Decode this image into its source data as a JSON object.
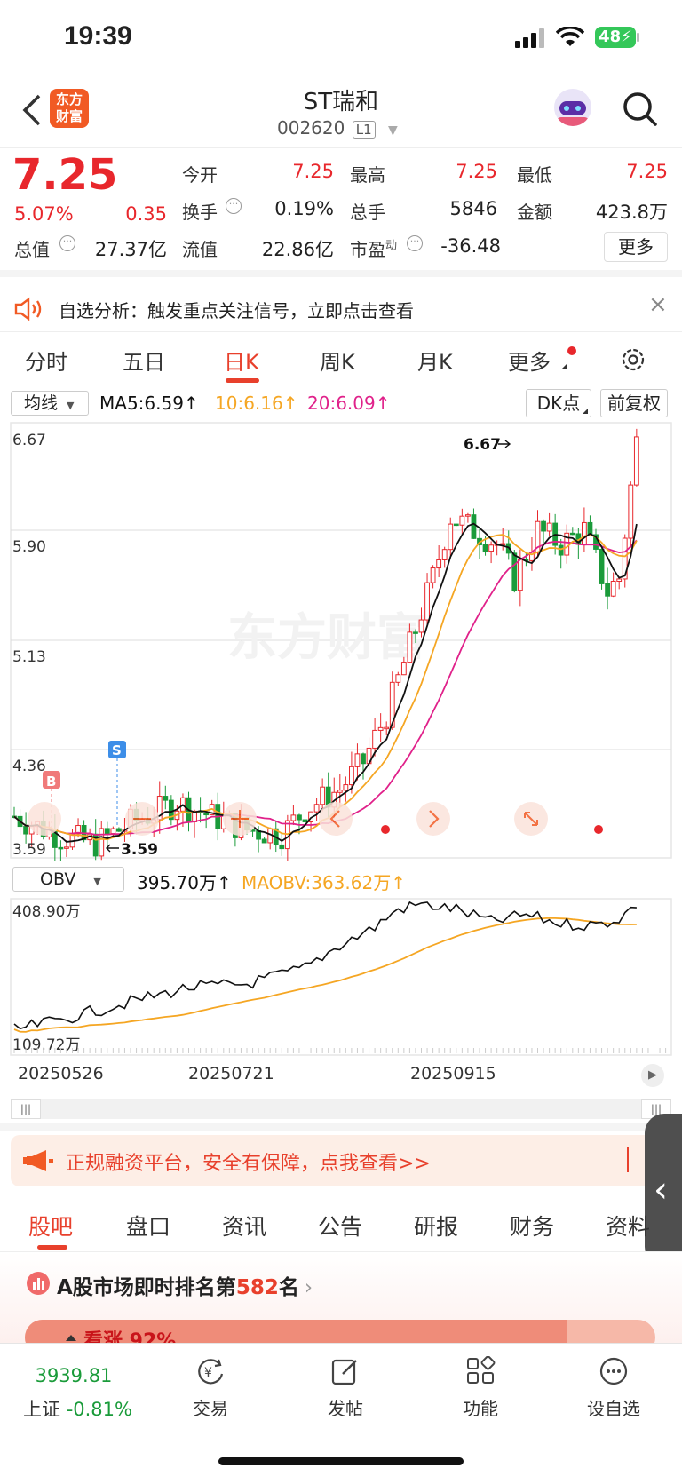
{
  "status": {
    "time": "19:39",
    "battery": "48"
  },
  "nav": {
    "logo_line1": "东方",
    "logo_line2": "财富",
    "title": "ST瑞和",
    "code": "002620",
    "level": "L1"
  },
  "quote": {
    "price": "7.25",
    "pct": "5.07%",
    "chg": "0.35",
    "row1": [
      {
        "l": "今开",
        "v": "7.25",
        "c": "red"
      },
      {
        "l": "最高",
        "v": "7.25",
        "c": "red"
      },
      {
        "l": "最低",
        "v": "7.25",
        "c": "red"
      }
    ],
    "row2": [
      {
        "l": "换手",
        "v": "0.19%"
      },
      {
        "l": "总手",
        "v": "5846"
      },
      {
        "l": "金额",
        "v": "423.8万"
      }
    ],
    "row3": [
      {
        "l": "总值",
        "v": "27.37亿"
      },
      {
        "l": "流值",
        "v": "22.86亿"
      },
      {
        "l": "市盈",
        "v": "-36.48"
      }
    ],
    "pe_sup": "动",
    "more": "更多"
  },
  "banner": {
    "text": "自选分析：触发重点关注信号，立即点击查看"
  },
  "tabs": [
    "分时",
    "五日",
    "日K",
    "周K",
    "月K",
    "更多"
  ],
  "active_tab": "日K",
  "chart": {
    "ma_select": "均线",
    "ma5": "MA5:6.59",
    "ma10": "10:6.16",
    "ma20": "20:6.09",
    "dk": "DK点",
    "fq": "前复权",
    "y_labels": [
      "6.67",
      "5.90",
      "5.13",
      "4.36",
      "3.59"
    ],
    "high_mark": "6.67",
    "low_mark": "3.59",
    "b_mark": "B",
    "s_mark": "S",
    "watermark": "东方财富",
    "obv_select": "OBV",
    "obv_val": "395.70万",
    "maobv": "MAOBV:363.62万",
    "obv_top": "408.90万",
    "obv_bottom": "109.72万",
    "dates": [
      "20250526",
      "20250721",
      "20250915"
    ],
    "colors": {
      "up": "#e8272c",
      "down": "#1a9b3a",
      "ma5": "#111111",
      "ma10": "#f5a623",
      "ma20": "#e0218a"
    }
  },
  "promo": {
    "text": "正规融资平台，安全有保障，点我查看>>"
  },
  "btabs": [
    "股吧",
    "盘口",
    "资讯",
    "公告",
    "研报",
    "财务",
    "资料"
  ],
  "rank": {
    "prefix": "A股市场即时排名第",
    "num": "582",
    "suffix": "名"
  },
  "peek": {
    "text": "看涨 92%"
  },
  "bottom": {
    "index_val": "3939.81",
    "index_name": "上证",
    "index_pct": "-0.81%",
    "items": [
      "交易",
      "发帖",
      "功能",
      "设自选"
    ]
  }
}
